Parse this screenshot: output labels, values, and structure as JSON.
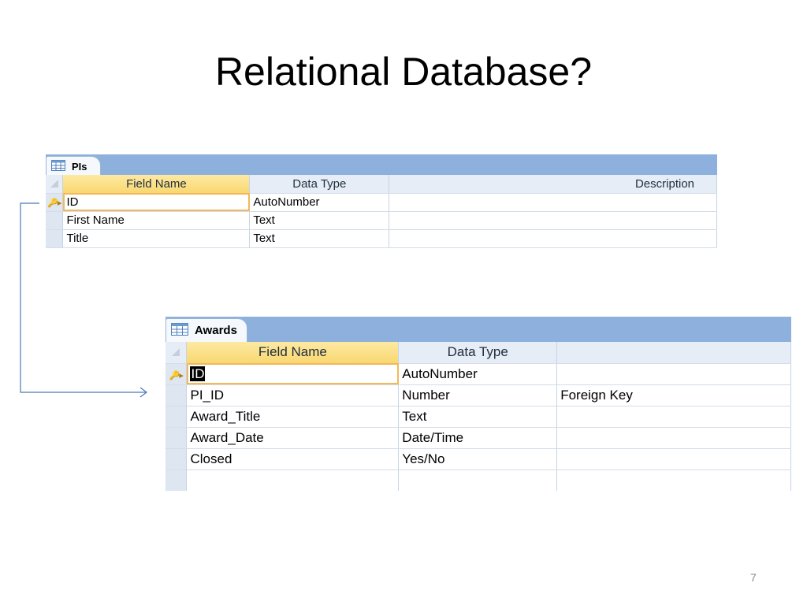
{
  "slide": {
    "title": "Relational Database?",
    "page_number": "7"
  },
  "tables": [
    {
      "tab_label": "PIs",
      "headers": [
        "Field Name",
        "Data Type",
        "Description"
      ],
      "rows": [
        {
          "field": "ID",
          "type": "AutoNumber",
          "description": ""
        },
        {
          "field": "First Name",
          "type": "Text",
          "description": ""
        },
        {
          "field": "Title",
          "type": "Text",
          "description": ""
        }
      ]
    },
    {
      "tab_label": "Awards",
      "headers": [
        "Field Name",
        "Data Type",
        ""
      ],
      "rows": [
        {
          "field": "ID",
          "type": "AutoNumber",
          "description": ""
        },
        {
          "field": "PI_ID",
          "type": "Number",
          "description": "Foreign Key"
        },
        {
          "field": "Award_Title",
          "type": "Text",
          "description": ""
        },
        {
          "field": "Award_Date",
          "type": "Date/Time",
          "description": ""
        },
        {
          "field": "Closed",
          "type": "Yes/No",
          "description": ""
        },
        {
          "field": "",
          "type": "",
          "description": ""
        }
      ]
    }
  ],
  "icons": {
    "table_icon": "datasheet-grid-icon",
    "primary_key": "key-icon",
    "row_selector": "current-row-arrow-icon"
  },
  "colors": {
    "tab_bar": "#8db0dc",
    "header_selected": "#f9d871",
    "connector": "#4a7ab8"
  }
}
